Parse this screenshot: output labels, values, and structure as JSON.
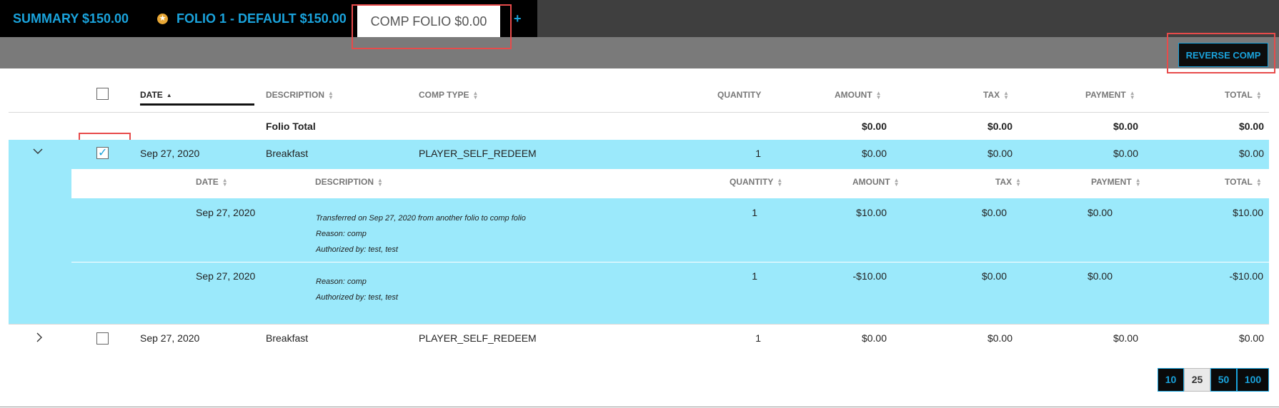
{
  "tabs": {
    "summary": "SUMMARY $150.00",
    "folio1": "FOLIO 1 - DEFAULT $150.00",
    "comp": "COMP FOLIO $0.00",
    "add": "+"
  },
  "toolbar": {
    "reverse_comp": "REVERSE COMP"
  },
  "table": {
    "headers": {
      "date": "DATE",
      "description": "DESCRIPTION",
      "comp_type": "COMP TYPE",
      "quantity": "QUANTITY",
      "amount": "AMOUNT",
      "tax": "TAX",
      "payment": "PAYMENT",
      "total": "TOTAL"
    },
    "folio_total": {
      "label": "Folio Total",
      "amount": "$0.00",
      "tax": "$0.00",
      "payment": "$0.00",
      "total": "$0.00"
    },
    "rows": [
      {
        "date": "Sep 27, 2020",
        "description": "Breakfast",
        "comp_type": "PLAYER_SELF_REDEEM",
        "quantity": "1",
        "amount": "$0.00",
        "tax": "$0.00",
        "payment": "$0.00",
        "total": "$0.00",
        "checked": true,
        "expanded": true
      },
      {
        "date": "Sep 27, 2020",
        "description": "Breakfast",
        "comp_type": "PLAYER_SELF_REDEEM",
        "quantity": "1",
        "amount": "$0.00",
        "tax": "$0.00",
        "payment": "$0.00",
        "total": "$0.00",
        "checked": false,
        "expanded": false
      }
    ],
    "detail": {
      "headers": {
        "date": "DATE",
        "description": "DESCRIPTION",
        "quantity": "QUANTITY",
        "amount": "AMOUNT",
        "tax": "TAX",
        "payment": "PAYMENT",
        "total": "TOTAL"
      },
      "rows": [
        {
          "date": "Sep 27, 2020",
          "lines": [
            "Transferred on Sep 27, 2020 from another folio to comp folio",
            "Reason: comp",
            "Authorized by: test, test"
          ],
          "quantity": "1",
          "amount": "$10.00",
          "tax": "$0.00",
          "payment": "$0.00",
          "total": "$10.00"
        },
        {
          "date": "Sep 27, 2020",
          "lines": [
            "Reason: comp",
            "Authorized by: test, test"
          ],
          "quantity": "1",
          "amount": "-$10.00",
          "tax": "$0.00",
          "payment": "$0.00",
          "total": "-$10.00"
        }
      ]
    }
  },
  "pagination": {
    "sizes": [
      "10",
      "25",
      "50",
      "100"
    ],
    "selected": "25"
  },
  "colors": {
    "accent": "#1aa3dc",
    "row_highlight": "#9be9fb",
    "annotation": "#e74b4b"
  },
  "icons": {
    "star": "star-icon",
    "expand": "chevron-down-icon",
    "collapse": "chevron-right-icon",
    "sort": "sort-icon"
  }
}
